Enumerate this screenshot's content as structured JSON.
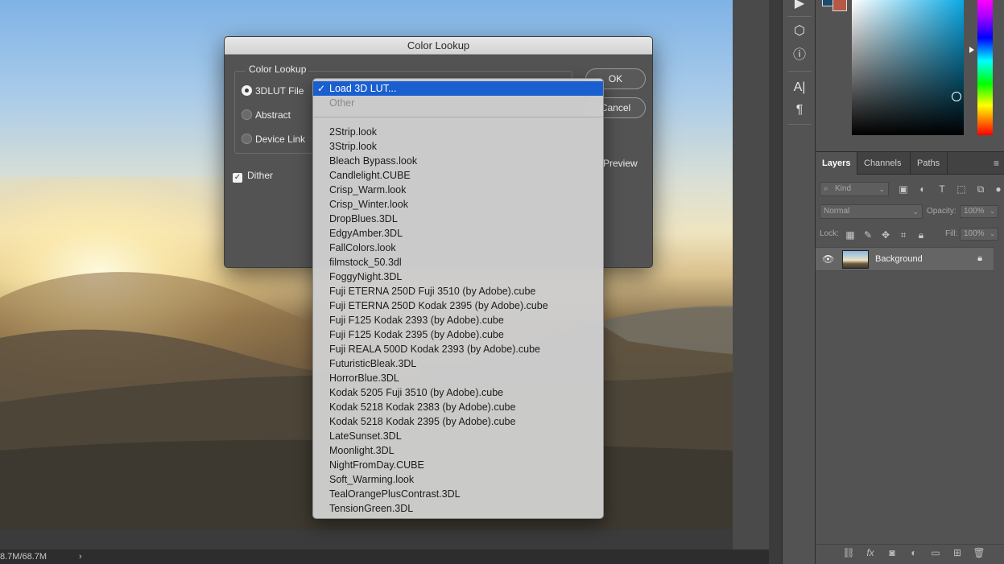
{
  "status": {
    "doc_size": "8.7M/68.7M",
    "arrow": "›"
  },
  "dialog": {
    "title": "Color Lookup",
    "group_label": "Color Lookup",
    "options": [
      {
        "label": "3DLUT File",
        "selected": true
      },
      {
        "label": "Abstract",
        "selected": false
      },
      {
        "label": "Device Link",
        "selected": false
      }
    ],
    "dither_label": "Dither",
    "dither_checked": true,
    "ok_label": "OK",
    "cancel_label": "Cancel",
    "preview_label": "Preview"
  },
  "dropdown": {
    "selected": "Load 3D LUT...",
    "other": "Other",
    "items": [
      "2Strip.look",
      "3Strip.look",
      "Bleach Bypass.look",
      "Candlelight.CUBE",
      "Crisp_Warm.look",
      "Crisp_Winter.look",
      "DropBlues.3DL",
      "EdgyAmber.3DL",
      "FallColors.look",
      "filmstock_50.3dl",
      "FoggyNight.3DL",
      "Fuji ETERNA 250D Fuji 3510 (by Adobe).cube",
      "Fuji ETERNA 250D Kodak 2395 (by Adobe).cube",
      "Fuji F125 Kodak 2393 (by Adobe).cube",
      "Fuji F125 Kodak 2395 (by Adobe).cube",
      "Fuji REALA 500D Kodak 2393 (by Adobe).cube",
      "FuturisticBleak.3DL",
      "HorrorBlue.3DL",
      "Kodak 5205 Fuji 3510 (by Adobe).cube",
      "Kodak 5218 Kodak 2383 (by Adobe).cube",
      "Kodak 5218 Kodak 2395 (by Adobe).cube",
      "LateSunset.3DL",
      "Moonlight.3DL",
      "NightFromDay.CUBE",
      "Soft_Warming.look",
      "TealOrangePlusContrast.3DL",
      "TensionGreen.3DL"
    ]
  },
  "layers_panel": {
    "tabs": [
      "Layers",
      "Channels",
      "Paths"
    ],
    "active_tab": "Layers",
    "kind_placeholder": "Kind",
    "blend_mode": "Normal",
    "opacity_label": "Opacity:",
    "opacity_value": "100%",
    "lock_label": "Lock:",
    "fill_label": "Fill:",
    "fill_value": "100%",
    "layers": [
      {
        "name": "Background",
        "visible": true,
        "locked": true
      }
    ]
  },
  "colors": {
    "accent": "#1a5fd0",
    "foreground_swatch": "#1c4a6a",
    "background_swatch": "#b65843"
  }
}
